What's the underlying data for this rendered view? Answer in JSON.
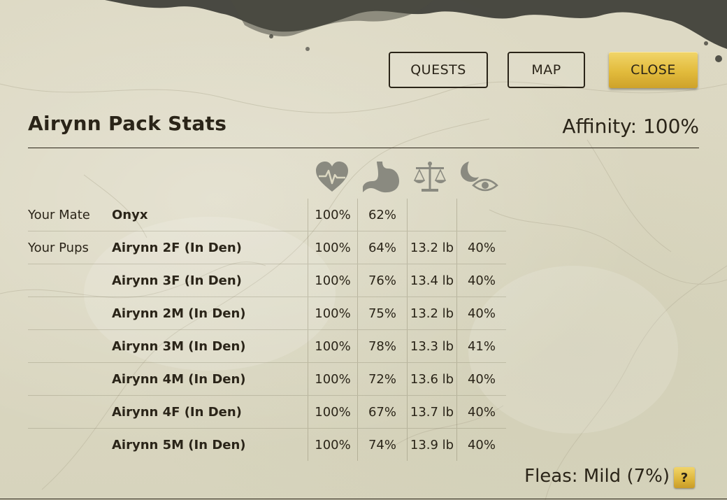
{
  "toolbar": {
    "quests_label": "QUESTS",
    "map_label": "MAP",
    "close_label": "CLOSE"
  },
  "header": {
    "title": "Airynn Pack Stats",
    "affinity": "Affinity: 100%"
  },
  "columns": {
    "icons": [
      "health-icon",
      "hunger-icon",
      "weight-icon",
      "sleep-icon"
    ]
  },
  "rows": [
    {
      "label": "Your Mate",
      "name": "Onyx",
      "health": "100%",
      "hunger": "62%",
      "weight": "",
      "sleep": ""
    },
    {
      "label": "Your Pups",
      "name": "Airynn 2F (In Den)",
      "health": "100%",
      "hunger": "64%",
      "weight": "13.2 lb",
      "sleep": "40%"
    },
    {
      "label": "",
      "name": "Airynn 3F (In Den)",
      "health": "100%",
      "hunger": "76%",
      "weight": "13.4 lb",
      "sleep": "40%"
    },
    {
      "label": "",
      "name": "Airynn 2M (In Den)",
      "health": "100%",
      "hunger": "75%",
      "weight": "13.2 lb",
      "sleep": "40%"
    },
    {
      "label": "",
      "name": "Airynn 3M (In Den)",
      "health": "100%",
      "hunger": "78%",
      "weight": "13.3 lb",
      "sleep": "41%"
    },
    {
      "label": "",
      "name": "Airynn 4M (In Den)",
      "health": "100%",
      "hunger": "72%",
      "weight": "13.6 lb",
      "sleep": "40%"
    },
    {
      "label": "",
      "name": "Airynn 4F (In Den)",
      "health": "100%",
      "hunger": "67%",
      "weight": "13.7 lb",
      "sleep": "40%"
    },
    {
      "label": "",
      "name": "Airynn 5M (In Den)",
      "health": "100%",
      "hunger": "74%",
      "weight": "13.9 lb",
      "sleep": "40%"
    }
  ],
  "footer": {
    "fleas": "Fleas: Mild (7%)",
    "help_label": "?"
  },
  "colors": {
    "accent_gold": "#e2bb3c",
    "ink": "#2a2418",
    "icon_gray": "#8a8a80"
  }
}
